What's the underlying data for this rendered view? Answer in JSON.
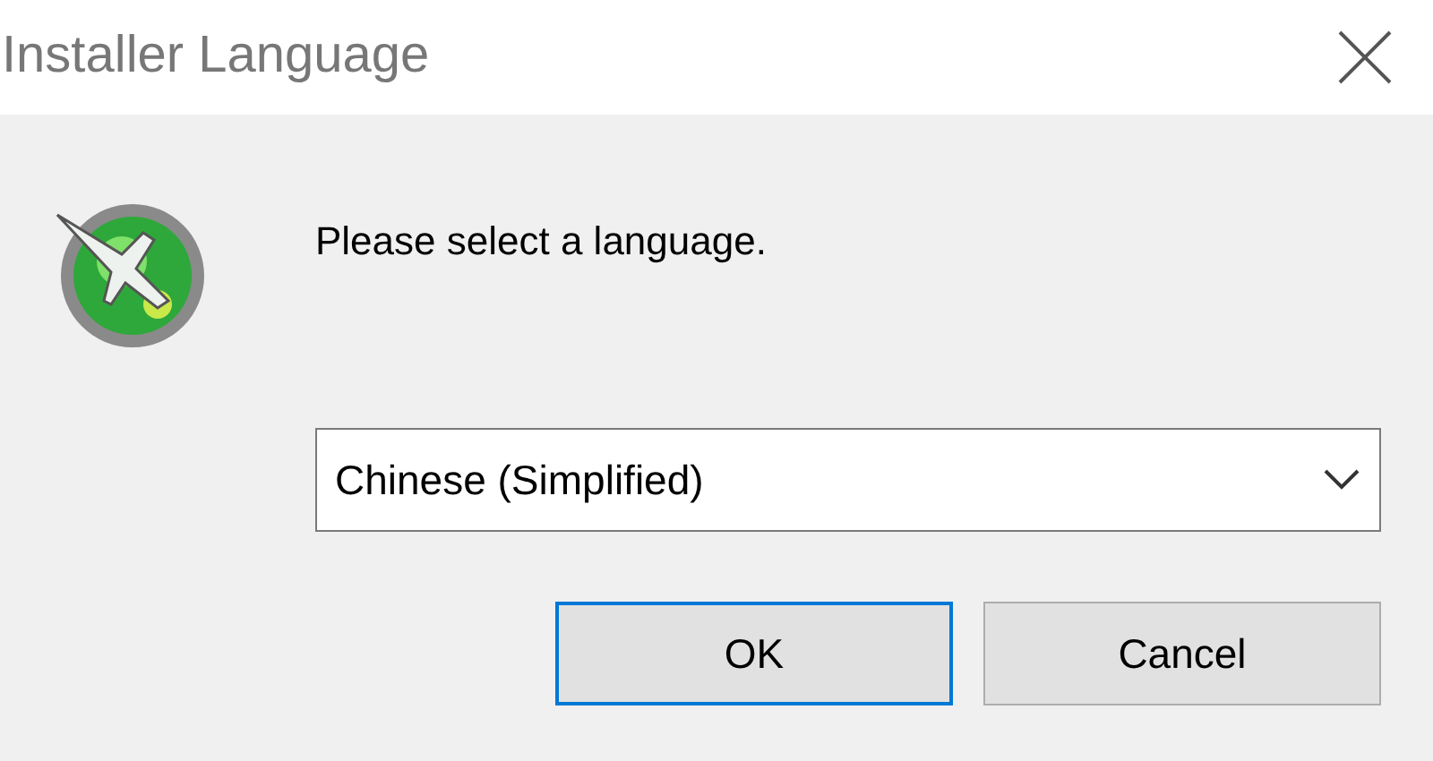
{
  "window": {
    "title": "Installer Language"
  },
  "message": "Please select a language.",
  "language_select": {
    "value": "Chinese (Simplified)"
  },
  "buttons": [
    {
      "label": "OK",
      "kind": "default"
    },
    {
      "label": "Cancel",
      "kind": "normal"
    }
  ]
}
